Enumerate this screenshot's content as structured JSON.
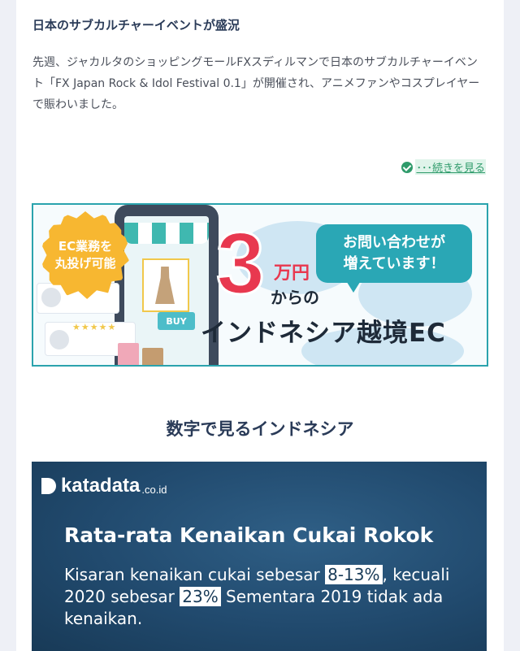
{
  "article": {
    "title": "日本のサブカルチャーイベントが盛況",
    "body": "先週、ジャカルタのショッピングモールFXスディルマンで日本のサブカルチャーイベント「FX Japan Rock & Idol Festival 0.1」が開催され、アニメファンやコスプレイヤーで賑わいました。",
    "read_more": "･･･続きを見る",
    "read_more_icon": "check-circle-icon"
  },
  "banner": {
    "badge_line1": "EC業務を",
    "badge_line2": "丸投げ可能",
    "big_number": "3",
    "unit": "万円",
    "from": "からの",
    "bubble_line1": "お問い合わせが",
    "bubble_line2": "増えています！",
    "main_text": "インドネシア越境EC",
    "buy_label": "BUY",
    "stars": "★★★★★",
    "colors": {
      "accent": "#e8384f",
      "teal": "#2aa7b5",
      "badge": "#f7b731"
    }
  },
  "section": {
    "heading": "数字で見るインドネシア"
  },
  "infographic": {
    "logo_name": "katadata",
    "logo_suffix": ".co.id",
    "title": "Rata-rata Kenaikan Cukai Rokok",
    "body_part1": "Kisaran kenaikan cukai sebesar ",
    "highlight1": "8-13%",
    "body_part2": ", kecuali 2020 sebesar ",
    "highlight2": "23%",
    "body_part3": " Sementara 2019 tidak ada kenaikan."
  }
}
